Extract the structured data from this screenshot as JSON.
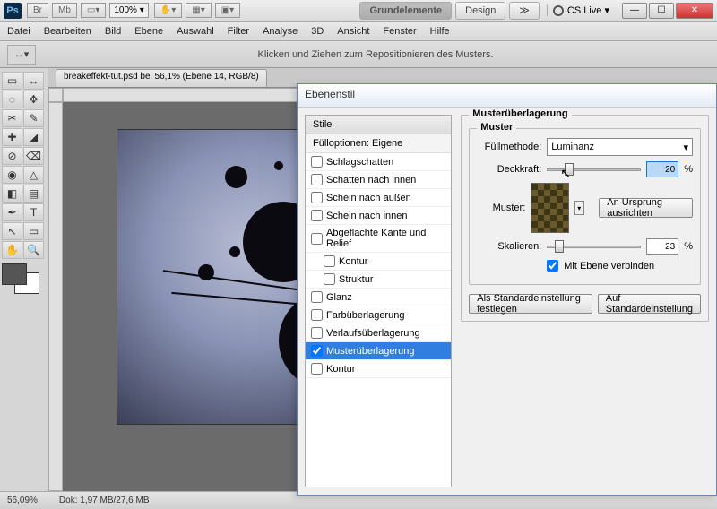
{
  "titlebar": {
    "zoom_sel": "100%",
    "ws_active": "Grundelemente",
    "ws_other": "Design",
    "cslive": "CS Live"
  },
  "menu": [
    "Datei",
    "Bearbeiten",
    "Bild",
    "Ebene",
    "Auswahl",
    "Filter",
    "Analyse",
    "3D",
    "Ansicht",
    "Fenster",
    "Hilfe"
  ],
  "options_hint": "Klicken und Ziehen zum Repositionieren des Musters.",
  "doc_tab": "breakeffekt-tut.psd bei 56,1% (Ebene 14, RGB/8)",
  "status_zoom": "56,09%",
  "status_doc": "Dok: 1,97 MB/27,6 MB",
  "dialog": {
    "title": "Ebenenstil",
    "col_head": "Stile",
    "fill_opts": "Fülloptionen: Eigene",
    "effects": [
      "Schlagschatten",
      "Schatten nach innen",
      "Schein nach außen",
      "Schein nach innen",
      "Abgeflachte Kante und Relief",
      "Kontur",
      "Struktur",
      "Glanz",
      "Farbüberlagerung",
      "Verlaufsüberlagerung",
      "Musterüberlagerung",
      "Kontur"
    ],
    "selected_idx": 10,
    "group_outer": "Musterüberlagerung",
    "group_inner": "Muster",
    "blend_label": "Füllmethode:",
    "blend_value": "Luminanz",
    "opacity_label": "Deckkraft:",
    "opacity_value": "20",
    "pattern_label": "Muster:",
    "snap_btn": "An Ursprung ausrichten",
    "scale_label": "Skalieren:",
    "scale_value": "23",
    "link_label": "Mit Ebene verbinden",
    "pct": "%",
    "default_btn": "Als Standardeinstellung festlegen",
    "reset_btn": "Auf Standardeinstellung"
  },
  "tool_icons": [
    "▭",
    "↔",
    "◌",
    "✥",
    "✂",
    "✎",
    "✚",
    "◢",
    "⊘",
    "⌫",
    "◉",
    "△",
    "◧",
    "▤",
    "✒",
    "T",
    "↖",
    "▭",
    "✋",
    "🔍"
  ]
}
